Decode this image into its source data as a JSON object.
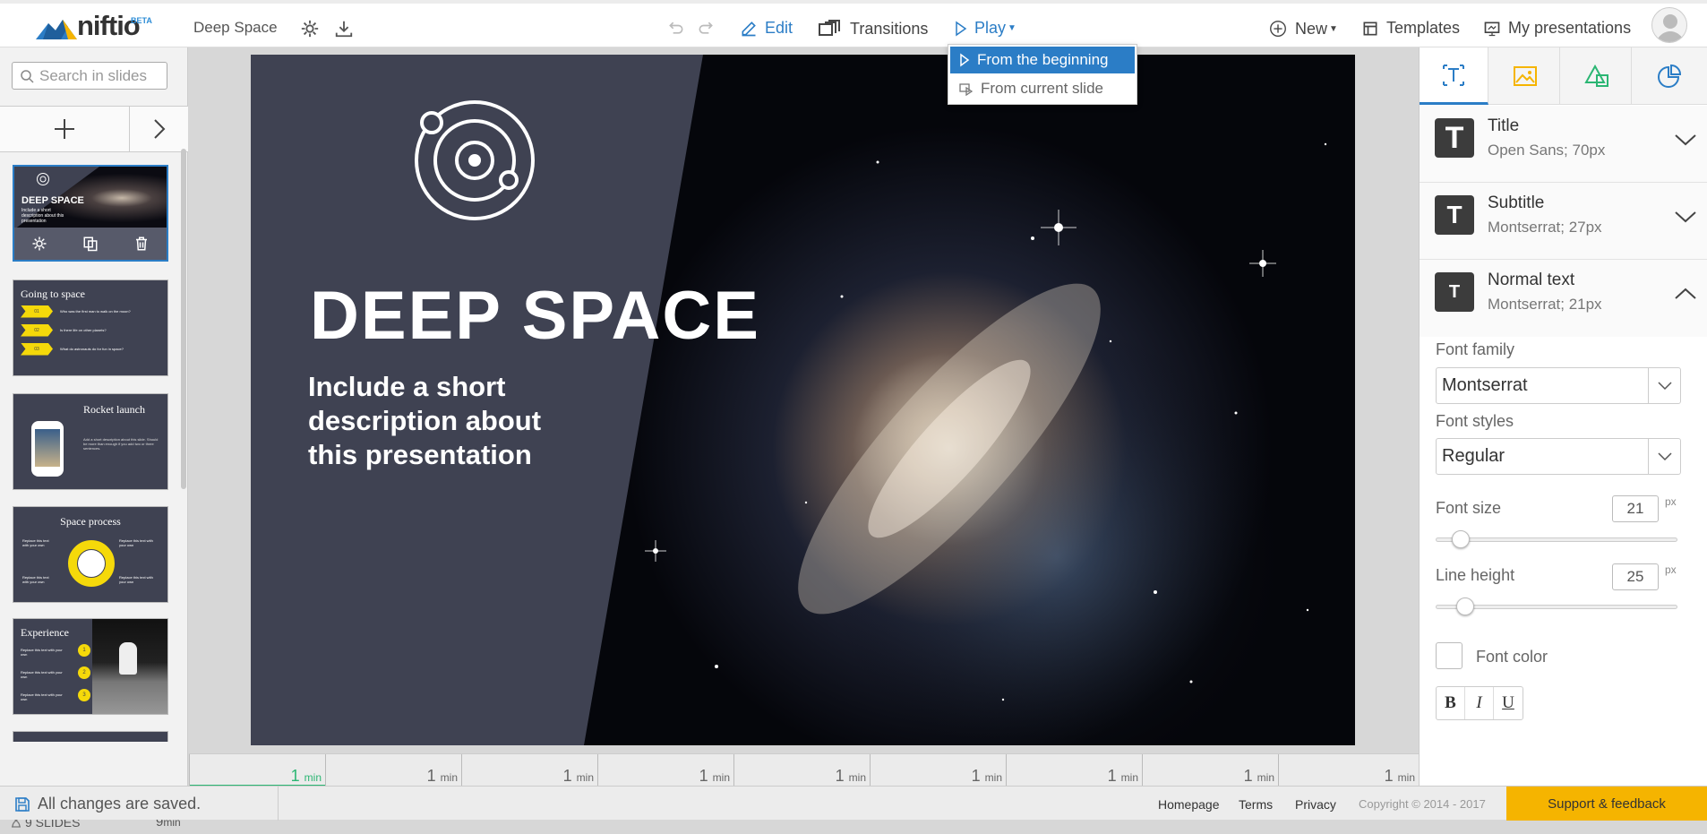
{
  "app": {
    "logo": "niftio",
    "beta": "BETA",
    "doc_title": "Deep Space"
  },
  "nav": {
    "edit": "Edit",
    "transitions": "Transitions",
    "play": "Play",
    "new": "New",
    "templates": "Templates",
    "my_presentations": "My presentations"
  },
  "play_menu": {
    "from_beginning": "From the beginning",
    "from_current": "From current slide"
  },
  "left": {
    "search_placeholder": "Search in slides",
    "slides": [
      {
        "title": "DEEP SPACE",
        "desc": "Include a short description about this presentation"
      },
      {
        "title": "Going to space",
        "rows": [
          {
            "num": "01",
            "text": "Who was the first man to walk on the moon?"
          },
          {
            "num": "02",
            "text": "Is there life on other planets?"
          },
          {
            "num": "03",
            "text": "What do astronauts do for fun in space?"
          }
        ]
      },
      {
        "title": "Rocket launch",
        "text": "Add a short description about this slide. Should be more than enough if you add two or three sentences."
      },
      {
        "title": "Space process",
        "notes": [
          "Replace this text with your own",
          "Replace this text with your own",
          "Replace this text with your own",
          "Replace this text with your own"
        ]
      },
      {
        "title": "Experience",
        "notes": [
          "Replace this text with your own",
          "Replace this text with your own",
          "Replace this text with your own"
        ],
        "badges": [
          "1",
          "2",
          "3"
        ]
      }
    ],
    "slide_count": "9 SLIDES",
    "total_time": "9",
    "total_unit": "min"
  },
  "slide": {
    "title": "DEEP SPACE",
    "subtitle_lines": [
      "Include a short",
      "description about",
      "this presentation"
    ]
  },
  "timeline": {
    "ticks": [
      {
        "value": "1",
        "unit": "min"
      },
      {
        "value": "1",
        "unit": "min"
      },
      {
        "value": "1",
        "unit": "min"
      },
      {
        "value": "1",
        "unit": "min"
      },
      {
        "value": "1",
        "unit": "min"
      },
      {
        "value": "1",
        "unit": "min"
      },
      {
        "value": "1",
        "unit": "min"
      },
      {
        "value": "1",
        "unit": "min"
      },
      {
        "value": "1",
        "unit": "min"
      }
    ]
  },
  "right": {
    "styles": [
      {
        "icon": "T",
        "name": "Title",
        "font": "Open Sans; 70px"
      },
      {
        "icon": "T",
        "name": "Subtitle",
        "font": "Montserrat; 27px"
      },
      {
        "icon": "T",
        "name": "Normal text",
        "font": "Montserrat; 21px"
      }
    ],
    "font_family_label": "Font family",
    "font_family": "Montserrat",
    "font_styles_label": "Font styles",
    "font_style": "Regular",
    "font_size_label": "Font size",
    "font_size": "21",
    "font_size_fraction": 0.07,
    "line_height_label": "Line height",
    "line_height": "25",
    "line_height_fraction": 0.09,
    "unit": "px",
    "font_color_label": "Font color",
    "bold": "B",
    "italic": "I",
    "underline": "U"
  },
  "footer": {
    "saved": "All changes are saved.",
    "homepage": "Homepage",
    "terms": "Terms",
    "privacy": "Privacy",
    "copyright": "Copyright © 2014 - 2017",
    "support": "Support & feedback"
  },
  "colors": {
    "accent": "#2b7dc6",
    "slide_panel": "#3f4252",
    "support": "#f5b400",
    "highlight": "#f5d90a"
  }
}
